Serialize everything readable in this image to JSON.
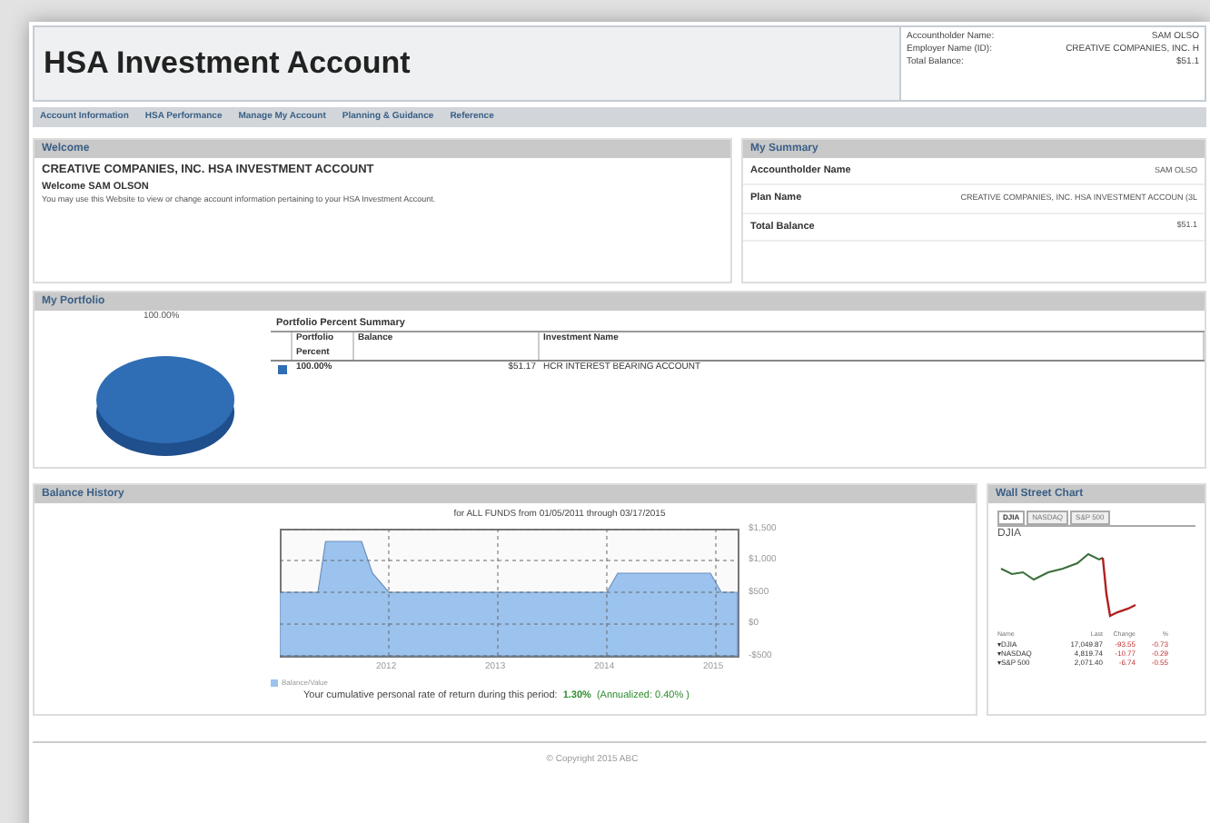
{
  "header": {
    "title": "HSA Investment Account",
    "info": [
      {
        "label": "Accountholder Name:",
        "value": "SAM OLSO"
      },
      {
        "label": "Employer Name (ID):",
        "value": "CREATIVE COMPANIES, INC. H"
      },
      {
        "label": "Total Balance:",
        "value": "$51.1"
      }
    ]
  },
  "nav": [
    "Account Information",
    "HSA Performance",
    "Manage My Account",
    "Planning & Guidance",
    "Reference"
  ],
  "welcome": {
    "title": "Welcome",
    "heading": "CREATIVE COMPANIES, INC. HSA INVESTMENT ACCOUNT",
    "greeting": "Welcome SAM OLSON",
    "text": "You may use this Website to view or change account information pertaining to your HSA Investment Account."
  },
  "summary": {
    "title": "My Summary",
    "rows": [
      {
        "label": "Accountholder Name",
        "value": "SAM OLSO"
      },
      {
        "label": "Plan Name",
        "value": "CREATIVE COMPANIES, INC. HSA INVESTMENT ACCOUN (3L"
      },
      {
        "label": "Total Balance",
        "value": "$51.1"
      }
    ]
  },
  "portfolio": {
    "title": "My Portfolio",
    "pie_label": "100.00%",
    "table_title": "Portfolio Percent Summary",
    "columns": [
      "Portfolio Percent",
      "Balance",
      "Investment Name"
    ],
    "rows": [
      {
        "color": "#2f6db5",
        "percent": "100.00%",
        "balance": "$51.17",
        "name": "HCR INTEREST BEARING ACCOUNT"
      }
    ]
  },
  "balance_history": {
    "title": "Balance History",
    "subtitle": "for ALL FUNDS from 01/05/2011 through 03/17/2015",
    "chart_data": {
      "type": "area",
      "x": [
        2011.0,
        2011.0,
        2011.35,
        2011.42,
        2011.75,
        2011.85,
        2012.0,
        2014.0,
        2014.1,
        2014.95,
        2015.05,
        2015.2,
        2015.2
      ],
      "series": [
        {
          "name": "Balance/Value",
          "color": "#9cc3ee",
          "values": [
            -500,
            500,
            500,
            1300,
            1300,
            800,
            500,
            500,
            800,
            800,
            500,
            500,
            -500
          ]
        }
      ],
      "xlim": [
        2011.0,
        2015.2
      ],
      "ylim": [
        -500,
        1500
      ],
      "grid": true,
      "xticks": [
        2012,
        2013,
        2014,
        2015
      ],
      "yticks": [
        {
          "value": 1500,
          "label": "$1,500"
        },
        {
          "value": 1000,
          "label": "$1,000"
        },
        {
          "value": 500,
          "label": "$500"
        },
        {
          "value": 0,
          "label": "$0"
        },
        {
          "value": -500,
          "label": "-$500"
        }
      ]
    },
    "return_text": "Your cumulative personal rate of return during this period:",
    "return_value": "1.30%",
    "annualized": "(Annualized: 0.40% )"
  },
  "wall_street": {
    "title": "Wall Street Chart",
    "tabs": [
      {
        "label": "DJIA",
        "selected": true
      },
      {
        "label": "NASDAQ",
        "selected": false
      },
      {
        "label": "S&P 500",
        "selected": false
      }
    ],
    "chart_title": "DJIA",
    "columns": [
      "Name",
      "Last",
      "Change",
      "%"
    ],
    "rows": [
      {
        "name": "▾DJIA",
        "last": "17,049.87",
        "change": "-93.55",
        "pct": "-0.73"
      },
      {
        "name": "▾NASDAQ",
        "last": "4,819.74",
        "change": "-10.77",
        "pct": "-0.29"
      },
      {
        "name": "▾S&P 500",
        "last": "2,071.40",
        "change": "-6.74",
        "pct": "-0.55"
      }
    ]
  },
  "footer": "© Copyright 2015 ABC"
}
